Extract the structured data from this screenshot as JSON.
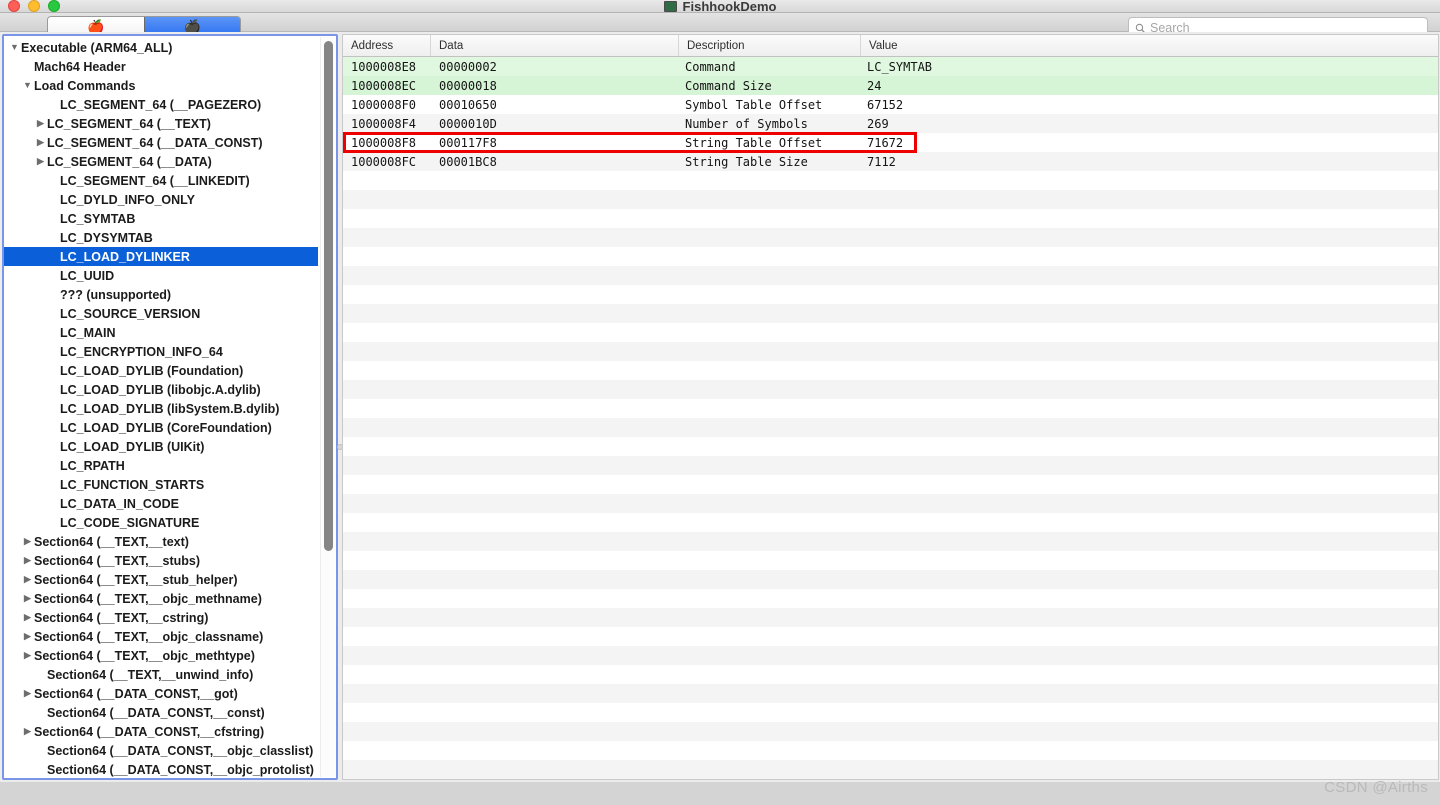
{
  "window": {
    "title": "FishhookDemo",
    "title_icon": "app-icon",
    "traffic_lights": [
      "close",
      "minimize",
      "zoom"
    ]
  },
  "toolbar": {
    "segments": [
      {
        "name": "fresh-apple-tab",
        "icon": "red-apple-icon",
        "glyph": "🍎",
        "selected": false
      },
      {
        "name": "rotten-apple-tab",
        "icon": "dark-apple-icon",
        "glyph": "🍎",
        "selected": true
      }
    ],
    "search": {
      "placeholder": "Search",
      "value": "",
      "icon": "search-icon"
    }
  },
  "sidebar": {
    "selected_index": 11,
    "scrollbar": {
      "name": "sidebar-scrollbar"
    },
    "items": [
      {
        "label": "Executable  (ARM64_ALL)",
        "indent": 0,
        "twisty": "down"
      },
      {
        "label": "Mach64 Header",
        "indent": 1,
        "twisty": "none"
      },
      {
        "label": "Load Commands",
        "indent": 1,
        "twisty": "down"
      },
      {
        "label": "LC_SEGMENT_64 (__PAGEZERO)",
        "indent": 3,
        "twisty": "none"
      },
      {
        "label": "LC_SEGMENT_64 (__TEXT)",
        "indent": 2,
        "twisty": "right"
      },
      {
        "label": "LC_SEGMENT_64 (__DATA_CONST)",
        "indent": 2,
        "twisty": "right"
      },
      {
        "label": "LC_SEGMENT_64 (__DATA)",
        "indent": 2,
        "twisty": "right"
      },
      {
        "label": "LC_SEGMENT_64 (__LINKEDIT)",
        "indent": 3,
        "twisty": "none"
      },
      {
        "label": "LC_DYLD_INFO_ONLY",
        "indent": 3,
        "twisty": "none"
      },
      {
        "label": "LC_SYMTAB",
        "indent": 3,
        "twisty": "none"
      },
      {
        "label": "LC_DYSYMTAB",
        "indent": 3,
        "twisty": "none"
      },
      {
        "label": "LC_LOAD_DYLINKER",
        "indent": 3,
        "twisty": "none"
      },
      {
        "label": "LC_UUID",
        "indent": 3,
        "twisty": "none"
      },
      {
        "label": "??? (unsupported)",
        "indent": 3,
        "twisty": "none"
      },
      {
        "label": "LC_SOURCE_VERSION",
        "indent": 3,
        "twisty": "none"
      },
      {
        "label": "LC_MAIN",
        "indent": 3,
        "twisty": "none"
      },
      {
        "label": "LC_ENCRYPTION_INFO_64",
        "indent": 3,
        "twisty": "none"
      },
      {
        "label": "LC_LOAD_DYLIB (Foundation)",
        "indent": 3,
        "twisty": "none"
      },
      {
        "label": "LC_LOAD_DYLIB (libobjc.A.dylib)",
        "indent": 3,
        "twisty": "none"
      },
      {
        "label": "LC_LOAD_DYLIB (libSystem.B.dylib)",
        "indent": 3,
        "twisty": "none"
      },
      {
        "label": "LC_LOAD_DYLIB (CoreFoundation)",
        "indent": 3,
        "twisty": "none"
      },
      {
        "label": "LC_LOAD_DYLIB (UIKit)",
        "indent": 3,
        "twisty": "none"
      },
      {
        "label": "LC_RPATH",
        "indent": 3,
        "twisty": "none"
      },
      {
        "label": "LC_FUNCTION_STARTS",
        "indent": 3,
        "twisty": "none"
      },
      {
        "label": "LC_DATA_IN_CODE",
        "indent": 3,
        "twisty": "none"
      },
      {
        "label": "LC_CODE_SIGNATURE",
        "indent": 3,
        "twisty": "none"
      },
      {
        "label": "Section64 (__TEXT,__text)",
        "indent": 1,
        "twisty": "right"
      },
      {
        "label": "Section64 (__TEXT,__stubs)",
        "indent": 1,
        "twisty": "right"
      },
      {
        "label": "Section64 (__TEXT,__stub_helper)",
        "indent": 1,
        "twisty": "right"
      },
      {
        "label": "Section64 (__TEXT,__objc_methname)",
        "indent": 1,
        "twisty": "right"
      },
      {
        "label": "Section64 (__TEXT,__cstring)",
        "indent": 1,
        "twisty": "right"
      },
      {
        "label": "Section64 (__TEXT,__objc_classname)",
        "indent": 1,
        "twisty": "right"
      },
      {
        "label": "Section64 (__TEXT,__objc_methtype)",
        "indent": 1,
        "twisty": "right"
      },
      {
        "label": "Section64 (__TEXT,__unwind_info)",
        "indent": 2,
        "twisty": "none"
      },
      {
        "label": "Section64 (__DATA_CONST,__got)",
        "indent": 1,
        "twisty": "right"
      },
      {
        "label": "Section64 (__DATA_CONST,__const)",
        "indent": 2,
        "twisty": "none"
      },
      {
        "label": "Section64 (__DATA_CONST,__cfstring)",
        "indent": 1,
        "twisty": "right"
      },
      {
        "label": "Section64 (__DATA_CONST,__objc_classlist)",
        "indent": 2,
        "twisty": "none"
      },
      {
        "label": "Section64 (__DATA_CONST,__objc_protolist)",
        "indent": 2,
        "twisty": "none"
      }
    ]
  },
  "table": {
    "columns": [
      "Address",
      "Data",
      "Description",
      "Value"
    ],
    "highlight_row_index": 4,
    "rows": [
      {
        "address": "1000008E8",
        "data": "00000002",
        "description": "Command",
        "value": "LC_SYMTAB",
        "style": "green"
      },
      {
        "address": "1000008EC",
        "data": "00000018",
        "description": "Command Size",
        "value": "24",
        "style": "green"
      },
      {
        "address": "1000008F0",
        "data": "00010650",
        "description": "Symbol Table Offset",
        "value": "67152",
        "style": "plain"
      },
      {
        "address": "1000008F4",
        "data": "0000010D",
        "description": "Number of Symbols",
        "value": "269",
        "style": "alt"
      },
      {
        "address": "1000008F8",
        "data": "000117F8",
        "description": "String Table Offset",
        "value": "71672",
        "style": "plain"
      },
      {
        "address": "1000008FC",
        "data": "00001BC8",
        "description": "String Table Size",
        "value": "7112",
        "style": "alt"
      }
    ]
  },
  "watermark": {
    "text": "CSDN @Airths"
  }
}
